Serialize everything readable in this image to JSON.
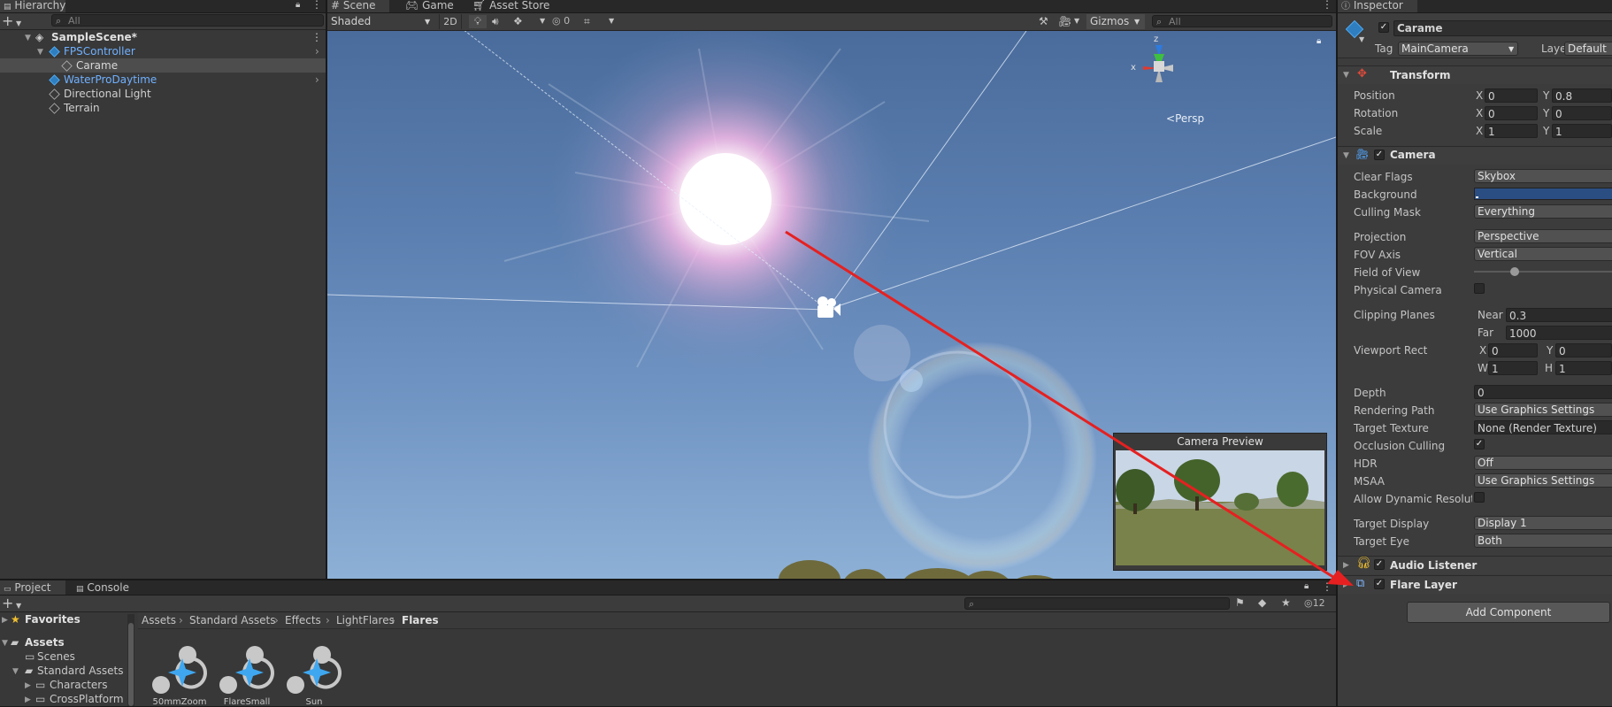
{
  "hierarchy": {
    "tab_label": "Hierarchy",
    "add_label": "+",
    "search_placeholder": "All",
    "menu_icon": "kebab-icon",
    "scene_name": "SampleScene*",
    "items": [
      {
        "label": "FPSController",
        "prefab": true
      },
      {
        "label": "Carame",
        "prefab": false
      },
      {
        "label": "WaterProDaytime",
        "prefab": true
      },
      {
        "label": "Directional Light",
        "prefab": false
      },
      {
        "label": "Terrain",
        "prefab": false
      }
    ]
  },
  "scene": {
    "tabs": [
      "Scene",
      "Game",
      "Asset Store"
    ],
    "shading_mode": "Shaded",
    "mode_2d": "2D",
    "hidden_count": "0",
    "gizmos_label": "Gizmos",
    "search_placeholder": "All",
    "persp_label": "Persp",
    "gizmo_axes": {
      "x": "x",
      "z": "z"
    },
    "camera_preview_title": "Camera Preview"
  },
  "project": {
    "tabs": [
      "Project",
      "Console"
    ],
    "add_label": "+",
    "visible_count": "12",
    "favorites_label": "Favorites",
    "assets_label": "Assets",
    "tree": [
      "Scenes",
      "Standard Assets",
      "Characters",
      "CrossPlatform"
    ],
    "breadcrumb": [
      "Assets",
      "Standard Assets",
      "Effects",
      "LightFlares",
      "Flares"
    ],
    "assets": [
      "50mmZoom",
      "FlareSmall",
      "Sun"
    ]
  },
  "inspector": {
    "tab_label": "Inspector",
    "object_name": "Carame",
    "tag_label": "Tag",
    "tag_value": "MainCamera",
    "layer_label": "Layer",
    "layer_value": "Default",
    "transform": {
      "title": "Transform",
      "position": {
        "label": "Position",
        "x": "0",
        "y": "0.8"
      },
      "rotation": {
        "label": "Rotation",
        "x": "0",
        "y": "0"
      },
      "scale": {
        "label": "Scale",
        "x": "1",
        "y": "1"
      }
    },
    "camera": {
      "title": "Camera",
      "clear_flags": {
        "label": "Clear Flags",
        "value": "Skybox"
      },
      "background": {
        "label": "Background",
        "color": "#2b4e82"
      },
      "culling_mask": {
        "label": "Culling Mask",
        "value": "Everything"
      },
      "projection": {
        "label": "Projection",
        "value": "Perspective"
      },
      "fov_axis": {
        "label": "FOV Axis",
        "value": "Vertical"
      },
      "field_of_view": {
        "label": "Field of View",
        "slider_fraction": 0.28
      },
      "physical_camera": {
        "label": "Physical Camera",
        "checked": false
      },
      "clipping": {
        "label": "Clipping Planes",
        "near_label": "Near",
        "near": "0.3",
        "far_label": "Far",
        "far": "1000"
      },
      "viewport": {
        "label": "Viewport Rect",
        "x": "0",
        "y": "0",
        "w": "1",
        "h": "1"
      },
      "depth": {
        "label": "Depth",
        "value": "0"
      },
      "rendering_path": {
        "label": "Rendering Path",
        "value": "Use Graphics Settings"
      },
      "target_texture": {
        "label": "Target Texture",
        "value": "None (Render Texture)"
      },
      "occlusion_culling": {
        "label": "Occlusion Culling",
        "checked": true
      },
      "hdr": {
        "label": "HDR",
        "value": "Off"
      },
      "msaa": {
        "label": "MSAA",
        "value": "Use Graphics Settings"
      },
      "dynamic_resolution": {
        "label": "Allow Dynamic Resoluti",
        "checked": false
      },
      "target_display": {
        "label": "Target Display",
        "value": "Display 1"
      },
      "target_eye": {
        "label": "Target Eye",
        "value": "Both"
      }
    },
    "audio_listener": "Audio Listener",
    "flare_layer": "Flare Layer",
    "add_component": "Add Component"
  },
  "colors": {
    "sky_top": "#4a6c9c",
    "sky_bottom": "#8db0d6",
    "annotation_arrow": "#e62020",
    "prefab_blue": "#6fb0ff"
  }
}
